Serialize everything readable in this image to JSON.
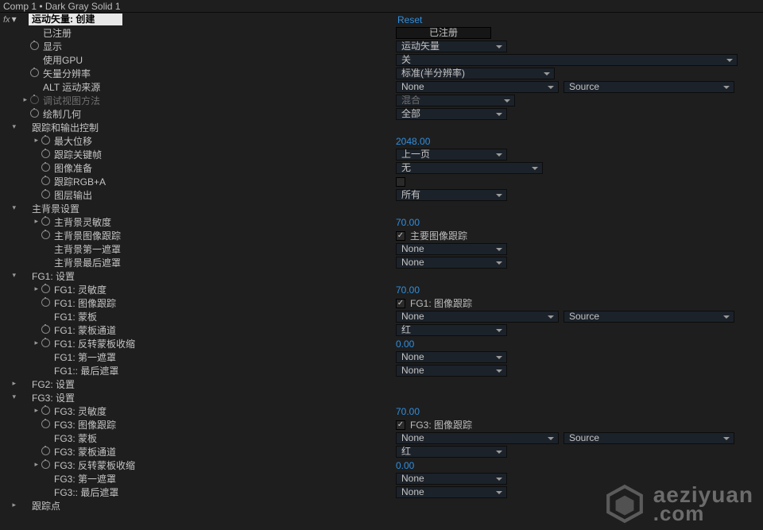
{
  "header": {
    "breadcrumb": "Comp 1 • Dark Gray Solid 1",
    "effect_name": "运动矢量: 创建",
    "reset": "Reset"
  },
  "rows": {
    "registered_label": "已注册",
    "registered_value": "已注册",
    "display": "显示",
    "display_val": "运动矢量",
    "use_gpu": "使用GPU",
    "use_gpu_val": "关",
    "vector_res": "矢量分辨率",
    "vector_res_val": "标准(半分辨率)",
    "alt_source": "ALT 运动来源",
    "alt_source_val": "None",
    "alt_source_side": "Source",
    "debug_view": "调试视图方法",
    "debug_view_val": "混合",
    "draw_geo": "绘制几何",
    "draw_geo_val": "全部"
  },
  "track": {
    "group": "跟踪和输出控制",
    "max_disp": "最大位移",
    "max_disp_val": "2048.00",
    "track_key": "跟踪关键帧",
    "track_key_val": "上一页",
    "image_prep": "图像准备",
    "image_prep_val": "无",
    "track_rgba": "跟踪RGB+A",
    "layer_out": "图层输出",
    "layer_out_val": "所有"
  },
  "mbg": {
    "group": "主背景设置",
    "sens": "主背景灵敏度",
    "sens_val": "70.00",
    "img_track": "主背景图像跟踪",
    "img_track_cb": "主要图像跟踪",
    "first_mask": "主背景第一遮罩",
    "first_mask_val": "None",
    "last_mask": "主背景最后遮罩",
    "last_mask_val": "None"
  },
  "fg1": {
    "group": "FG1: 设置",
    "sens": "FG1: 灵敏度",
    "sens_val": "70.00",
    "img_track": "FG1: 图像跟踪",
    "img_track_cb": "FG1: 图像跟踪",
    "mask": "FG1: 蒙板",
    "mask_val": "None",
    "mask_side": "Source",
    "mask_ch": "FG1: 蒙板通道",
    "mask_ch_val": "红",
    "inv_shrink": "FG1: 反转蒙板收缩",
    "inv_shrink_val": "0.00",
    "first_mask": "FG1: 第一遮罩",
    "first_mask_val": "None",
    "last_mask": "FG1:: 最后遮罩",
    "last_mask_val": "None"
  },
  "fg2": {
    "group": "FG2: 设置"
  },
  "fg3": {
    "group": "FG3: 设置",
    "sens": "FG3: 灵敏度",
    "sens_val": "70.00",
    "img_track": "FG3: 图像跟踪",
    "img_track_cb": "FG3: 图像跟踪",
    "mask": "FG3: 蒙板",
    "mask_val": "None",
    "mask_side": "Source",
    "mask_ch": "FG3: 蒙板通道",
    "mask_ch_val": "红",
    "inv_shrink": "FG3: 反转蒙板收缩",
    "inv_shrink_val": "0.00",
    "first_mask": "FG3: 第一遮罩",
    "first_mask_val": "None",
    "last_mask": "FG3:: 最后遮罩",
    "last_mask_val": "None"
  },
  "trackpts": {
    "group": "跟踪点"
  },
  "watermark": {
    "line1": "aeziyuan",
    "line2": ".com"
  }
}
